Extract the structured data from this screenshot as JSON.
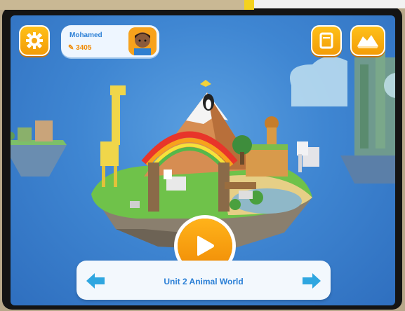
{
  "profile": {
    "name": "Mohamed",
    "score": "3405"
  },
  "unit": {
    "title": "Unit 2 Animal World"
  },
  "icons": {
    "settings": "gear-icon",
    "score": "pencil-icon",
    "book": "book-icon",
    "map": "map-icon",
    "play": "play-icon",
    "prev": "arrow-left-icon",
    "next": "arrow-right-icon"
  },
  "colors": {
    "accent": "#f7a21c",
    "text_blue": "#2a7fd6",
    "sky": "#3f86d2",
    "arrow": "#2fa6e0"
  }
}
